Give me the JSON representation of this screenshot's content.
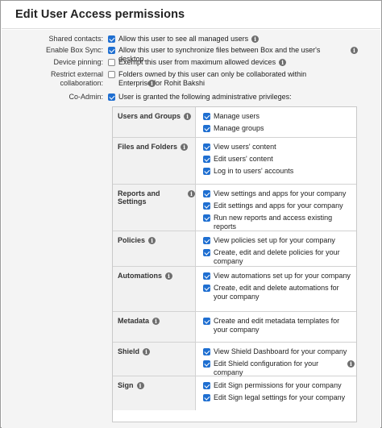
{
  "dialog": {
    "title": "Edit User Access permissions"
  },
  "settings": [
    {
      "label": "Shared contacts:",
      "checked": true,
      "text": "Allow this user to see all managed users",
      "info": true
    },
    {
      "label": "Enable Box Sync:",
      "checked": true,
      "text": "Allow this user to synchronize files between Box and the user's desktop.",
      "info": true
    },
    {
      "label": "Device pinning:",
      "checked": false,
      "text": "Exempt this user from maximum allowed devices",
      "info": true
    },
    {
      "label": "Restrict external collaboration:",
      "checked": false,
      "text": "Folders owned by this user can only be collaborated within Enterprise for Rohit Bakshi",
      "info": true
    },
    {
      "label": "Co-Admin:",
      "checked": true,
      "text": "User is granted the following administrative privileges:",
      "info": false
    }
  ],
  "privileges": [
    {
      "category": "Users and Groups",
      "info": true,
      "items": [
        {
          "text": "Manage users",
          "checked": true
        },
        {
          "text": "Manage groups",
          "checked": true
        }
      ]
    },
    {
      "category": "Files and Folders",
      "info": true,
      "items": [
        {
          "text": "View users' content",
          "checked": true
        },
        {
          "text": "Edit users' content",
          "checked": true
        },
        {
          "text": "Log in to users' accounts",
          "checked": true
        }
      ]
    },
    {
      "category": "Reports and Settings",
      "info": true,
      "items": [
        {
          "text": "View settings and apps for your company",
          "checked": true
        },
        {
          "text": "Edit settings and apps for your company",
          "checked": true
        },
        {
          "text": "Run new reports and access existing reports",
          "checked": true
        }
      ]
    },
    {
      "category": "Policies",
      "info": true,
      "items": [
        {
          "text": "View policies set up for your company",
          "checked": true
        },
        {
          "text": "Create, edit and delete policies for your company",
          "checked": true
        }
      ]
    },
    {
      "category": "Automations",
      "info": true,
      "items": [
        {
          "text": "View automations set up for your company",
          "checked": true
        },
        {
          "text": "Create, edit and delete automations for your company",
          "checked": true
        }
      ]
    },
    {
      "category": "Metadata",
      "info": true,
      "items": [
        {
          "text": "Create and edit metadata templates for your company",
          "checked": true
        }
      ]
    },
    {
      "category": "Shield",
      "info": true,
      "items": [
        {
          "text": "View Shield Dashboard for your company",
          "checked": true
        },
        {
          "text": "Edit Shield configuration for your company",
          "checked": true,
          "info": true
        }
      ]
    },
    {
      "category": "Sign",
      "info": true,
      "items": [
        {
          "text": "Edit Sign permissions for your company",
          "checked": true
        },
        {
          "text": "Edit Sign legal settings for your company",
          "checked": true
        }
      ]
    }
  ],
  "colors": {
    "checkbox": "#1f6fd1",
    "panel_bg": "#f4f4f4",
    "category_bg": "#f1f1f1",
    "info_icon": "#6e6e6e"
  },
  "icons": {
    "checkbox_checked": "checkbox-checked-icon",
    "checkbox_unchecked": "checkbox-unchecked-icon",
    "info": "info-icon"
  }
}
